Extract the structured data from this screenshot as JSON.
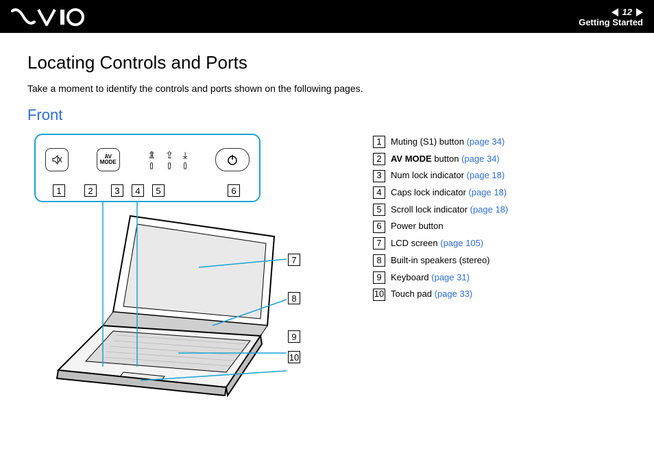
{
  "header": {
    "page_number": "12",
    "section": "Getting Started"
  },
  "title": "Locating Controls and Ports",
  "intro": "Take a moment to identify the controls and ports shown on the following pages.",
  "subtitle": "Front",
  "panel": {
    "btn2_label": "AV MODE"
  },
  "legend": [
    {
      "num": "1",
      "text": "Muting (S1) button ",
      "link": "(page 34)"
    },
    {
      "num": "2",
      "bold": "AV MODE",
      "text": " button ",
      "link": "(page 34)"
    },
    {
      "num": "3",
      "text": "Num lock indicator ",
      "link": "(page 18)"
    },
    {
      "num": "4",
      "text": "Caps lock indicator ",
      "link": "(page 18)"
    },
    {
      "num": "5",
      "text": "Scroll lock indicator ",
      "link": "(page 18)"
    },
    {
      "num": "6",
      "text": "Power button",
      "link": ""
    },
    {
      "num": "7",
      "text": "LCD screen ",
      "link": "(page 105)"
    },
    {
      "num": "8",
      "text": "Built-in speakers (stereo)",
      "link": ""
    },
    {
      "num": "9",
      "text": "Keyboard ",
      "link": "(page 31)"
    },
    {
      "num": "10",
      "text": "Touch pad ",
      "link": "(page 33)"
    }
  ],
  "callouts": {
    "c7": "7",
    "c8": "8",
    "c9": "9",
    "c10": "10",
    "p1": "1",
    "p2": "2",
    "p3": "3",
    "p4": "4",
    "p5": "5",
    "p6": "6"
  }
}
